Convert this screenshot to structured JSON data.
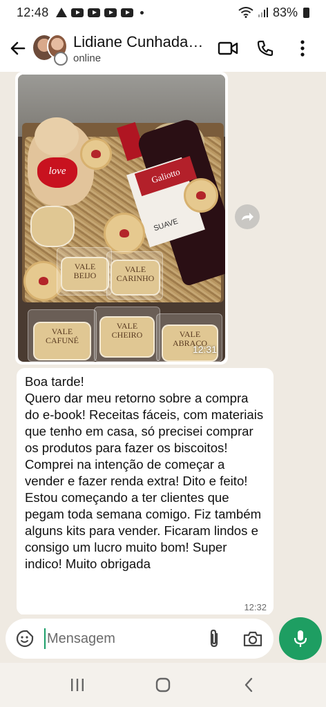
{
  "status_bar": {
    "time": "12:48",
    "battery": "83%"
  },
  "header": {
    "contact_name": "Lidiane Cunhada…",
    "contact_status": "online"
  },
  "messages": [
    {
      "type": "image",
      "time": "12:31",
      "cookie_texts": [
        "VALE BEIJO",
        "VALE CARINHO",
        "VALE CAFUNÉ",
        "VALE CHEIRO",
        "VALE ABRAÇO"
      ],
      "plush_text": "love",
      "wine_label": "Galiotto",
      "wine_type": "SUAVE"
    },
    {
      "type": "text",
      "text": "Boa tarde!\nQuero dar meu retorno sobre a compra do e-book! Receitas fáceis, com materiais que tenho em casa, só precisei comprar os produtos para fazer os biscoitos! Comprei na intenção de começar a vender e fazer renda extra! Dito e feito! Estou começando a ter clientes que pegam toda semana comigo. Fiz também alguns kits para vender. Ficaram lindos e consigo um lucro muito bom! Super indico! Muito obrigada",
      "time": "12:32"
    }
  ],
  "composer": {
    "placeholder": "Mensagem"
  },
  "colors": {
    "accent_green": "#1e9e62",
    "chat_background": "#efeae2",
    "bubble": "#ffffff"
  },
  "icons": {
    "back": "arrow-left-icon",
    "video": "video-camera-icon",
    "call": "phone-icon",
    "menu": "more-vertical-icon",
    "forward": "forward-icon",
    "emoji": "sticker-icon",
    "attach": "paperclip-icon",
    "camera": "camera-icon",
    "mic": "microphone-icon"
  }
}
